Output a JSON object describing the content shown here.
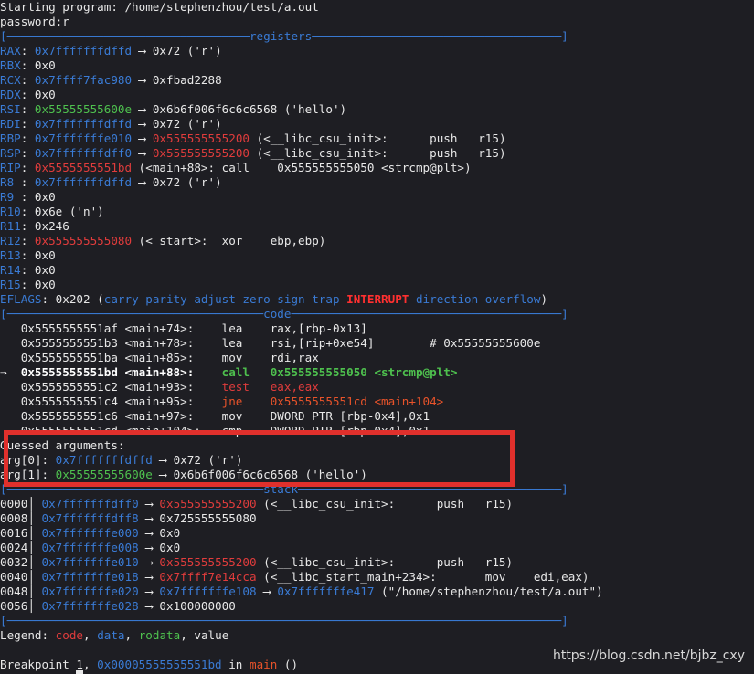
{
  "terminal": {
    "lines": [
      [
        {
          "t": "Starting program: /home/stephenzhou/test/a.out",
          "c": "white"
        }
      ],
      [
        {
          "t": "password:r",
          "c": "white"
        }
      ],
      [
        {
          "t": "[───────────────────────────────────registers────────────────────────────────────]",
          "c": "sep"
        }
      ],
      [
        {
          "t": "RAX",
          "c": "blue"
        },
        {
          "t": ": ",
          "c": "white"
        },
        {
          "t": "0x7fffffffdffd",
          "c": "blue"
        },
        {
          "t": " ⟶ 0x72 ('r')",
          "c": "white"
        }
      ],
      [
        {
          "t": "RBX",
          "c": "blue"
        },
        {
          "t": ": 0x0",
          "c": "white"
        }
      ],
      [
        {
          "t": "RCX",
          "c": "blue"
        },
        {
          "t": ": ",
          "c": "white"
        },
        {
          "t": "0x7ffff7fac980",
          "c": "blue"
        },
        {
          "t": " ⟶ 0xfbad2288",
          "c": "white"
        }
      ],
      [
        {
          "t": "RDX",
          "c": "blue"
        },
        {
          "t": ": 0x0",
          "c": "white"
        }
      ],
      [
        {
          "t": "RSI",
          "c": "blue"
        },
        {
          "t": ": ",
          "c": "white"
        },
        {
          "t": "0x55555555600e",
          "c": "green"
        },
        {
          "t": " ⟶ 0x6b6f006f6c6c6568 ('hello')",
          "c": "white"
        }
      ],
      [
        {
          "t": "RDI",
          "c": "blue"
        },
        {
          "t": ": ",
          "c": "white"
        },
        {
          "t": "0x7fffffffdffd",
          "c": "blue"
        },
        {
          "t": " ⟶ 0x72 ('r')",
          "c": "white"
        }
      ],
      [
        {
          "t": "RBP",
          "c": "blue"
        },
        {
          "t": ": ",
          "c": "white"
        },
        {
          "t": "0x7fffffffe010",
          "c": "blue"
        },
        {
          "t": " ⟶ ",
          "c": "white"
        },
        {
          "t": "0x555555555200",
          "c": "red"
        },
        {
          "t": " (<__libc_csu_init>:      push   r15)",
          "c": "white"
        }
      ],
      [
        {
          "t": "RSP",
          "c": "blue"
        },
        {
          "t": ": ",
          "c": "white"
        },
        {
          "t": "0x7fffffffdff0",
          "c": "blue"
        },
        {
          "t": " ⟶ ",
          "c": "white"
        },
        {
          "t": "0x555555555200",
          "c": "red"
        },
        {
          "t": " (<__libc_csu_init>:      push   r15)",
          "c": "white"
        }
      ],
      [
        {
          "t": "RIP",
          "c": "blue"
        },
        {
          "t": ": ",
          "c": "white"
        },
        {
          "t": "0x5555555551bd",
          "c": "red"
        },
        {
          "t": " (<main+88>: call    0x555555555050 <strcmp@plt>)",
          "c": "white"
        }
      ],
      [
        {
          "t": "R8 ",
          "c": "blue"
        },
        {
          "t": ": ",
          "c": "white"
        },
        {
          "t": "0x7fffffffdffd",
          "c": "blue"
        },
        {
          "t": " ⟶ 0x72 ('r')",
          "c": "white"
        }
      ],
      [
        {
          "t": "R9 ",
          "c": "blue"
        },
        {
          "t": ": 0x0",
          "c": "white"
        }
      ],
      [
        {
          "t": "R10",
          "c": "blue"
        },
        {
          "t": ": 0x6e ('n')",
          "c": "white"
        }
      ],
      [
        {
          "t": "R11",
          "c": "blue"
        },
        {
          "t": ": 0x246",
          "c": "white"
        }
      ],
      [
        {
          "t": "R12",
          "c": "blue"
        },
        {
          "t": ": ",
          "c": "white"
        },
        {
          "t": "0x555555555080",
          "c": "red"
        },
        {
          "t": " (<_start>:  xor    ebp,ebp)",
          "c": "white"
        }
      ],
      [
        {
          "t": "R13",
          "c": "blue"
        },
        {
          "t": ": 0x0",
          "c": "white"
        }
      ],
      [
        {
          "t": "R14",
          "c": "blue"
        },
        {
          "t": ": 0x0",
          "c": "white"
        }
      ],
      [
        {
          "t": "R15",
          "c": "blue"
        },
        {
          "t": ": 0x0",
          "c": "white"
        }
      ],
      [
        {
          "t": "EFLAGS",
          "c": "blue"
        },
        {
          "t": ": 0x202 (",
          "c": "white"
        },
        {
          "t": "carry parity adjust zero sign trap ",
          "c": "blue"
        },
        {
          "t": "INTERRUPT",
          "c": "hred"
        },
        {
          "t": " direction overflow",
          "c": "blue"
        },
        {
          "t": ")",
          "c": "white"
        }
      ],
      [
        {
          "t": "[─────────────────────────────────────code───────────────────────────────────────]",
          "c": "sep"
        }
      ],
      [
        {
          "t": "   0x5555555551af <main+74>:    lea    rax,[rbp-0x13]",
          "c": "white"
        }
      ],
      [
        {
          "t": "   0x5555555551b3 <main+78>:    lea    rsi,[rip+0xe54]        # 0x55555555600e",
          "c": "white"
        }
      ],
      [
        {
          "t": "   0x5555555551ba <main+85>:    mov    rdi,rax",
          "c": "white"
        }
      ],
      [
        {
          "t": "⇒  0x5555555551bd <main+88>:    ",
          "c": "whiteb"
        },
        {
          "t": "call   0x555555555050 <strcmp@plt>",
          "c": "greenb"
        }
      ],
      [
        {
          "t": "   0x5555555551c2 <main+93>:    ",
          "c": "white"
        },
        {
          "t": "test   eax,eax",
          "c": "red"
        }
      ],
      [
        {
          "t": "   0x5555555551c4 <main+95>:    ",
          "c": "white"
        },
        {
          "t": "jne    0x5555555551cd <main+104>",
          "c": "orange"
        }
      ],
      [
        {
          "t": "   0x5555555551c6 <main+97>:    mov    DWORD PTR [rbp-0x4],0x1",
          "c": "white"
        }
      ],
      [
        {
          "t": "   0x5555555551cd <main+104>:   cmp    DWORD PTR [rbp-0x4],0x1",
          "c": "white"
        }
      ],
      [
        {
          "t": "Guessed arguments:",
          "c": "white"
        }
      ],
      [
        {
          "t": "arg[0]: ",
          "c": "white"
        },
        {
          "t": "0x7fffffffdffd",
          "c": "blue"
        },
        {
          "t": " ⟶ 0x72 ('r')",
          "c": "white"
        }
      ],
      [
        {
          "t": "arg[1]: ",
          "c": "white"
        },
        {
          "t": "0x55555555600e",
          "c": "green"
        },
        {
          "t": " ⟶ 0x6b6f006f6c6c6568 ('hello')",
          "c": "white"
        }
      ],
      [
        {
          "t": "[─────────────────────────────────────stack──────────────────────────────────────]",
          "c": "sep"
        }
      ],
      [
        {
          "t": "0000│ ",
          "c": "white"
        },
        {
          "t": "0x7fffffffdff0",
          "c": "blue"
        },
        {
          "t": " ⟶ ",
          "c": "white"
        },
        {
          "t": "0x555555555200",
          "c": "red"
        },
        {
          "t": " (<__libc_csu_init>:      push   r15)",
          "c": "white"
        }
      ],
      [
        {
          "t": "0008│ ",
          "c": "white"
        },
        {
          "t": "0x7fffffffdff8",
          "c": "blue"
        },
        {
          "t": " ⟶ 0x725555555080",
          "c": "white"
        }
      ],
      [
        {
          "t": "0016│ ",
          "c": "white"
        },
        {
          "t": "0x7fffffffe000",
          "c": "blue"
        },
        {
          "t": " ⟶ 0x0",
          "c": "white"
        }
      ],
      [
        {
          "t": "0024│ ",
          "c": "white"
        },
        {
          "t": "0x7fffffffe008",
          "c": "blue"
        },
        {
          "t": " ⟶ 0x0",
          "c": "white"
        }
      ],
      [
        {
          "t": "0032│ ",
          "c": "white"
        },
        {
          "t": "0x7fffffffe010",
          "c": "blue"
        },
        {
          "t": " ⟶ ",
          "c": "white"
        },
        {
          "t": "0x555555555200",
          "c": "red"
        },
        {
          "t": " (<__libc_csu_init>:      push   r15)",
          "c": "white"
        }
      ],
      [
        {
          "t": "0040│ ",
          "c": "white"
        },
        {
          "t": "0x7fffffffe018",
          "c": "blue"
        },
        {
          "t": " ⟶ ",
          "c": "white"
        },
        {
          "t": "0x7ffff7e14cca",
          "c": "red"
        },
        {
          "t": " (<__libc_start_main+234>:       mov    edi,eax)",
          "c": "white"
        }
      ],
      [
        {
          "t": "0048│ ",
          "c": "white"
        },
        {
          "t": "0x7fffffffe020",
          "c": "blue"
        },
        {
          "t": " ⟶ ",
          "c": "white"
        },
        {
          "t": "0x7fffffffe108",
          "c": "blue"
        },
        {
          "t": " ⟶ ",
          "c": "white"
        },
        {
          "t": "0x7fffffffe417",
          "c": "blue"
        },
        {
          "t": " (\"/home/stephenzhou/test/a.out\")",
          "c": "white"
        }
      ],
      [
        {
          "t": "0056│ ",
          "c": "white"
        },
        {
          "t": "0x7fffffffe028",
          "c": "blue"
        },
        {
          "t": " ⟶ 0x100000000",
          "c": "white"
        }
      ],
      [
        {
          "t": "[────────────────────────────────────────────────────────────────────────────────]",
          "c": "sep"
        }
      ],
      [
        {
          "t": "Legend: ",
          "c": "white"
        },
        {
          "t": "code",
          "c": "red"
        },
        {
          "t": ", ",
          "c": "white"
        },
        {
          "t": "data",
          "c": "blue"
        },
        {
          "t": ", ",
          "c": "white"
        },
        {
          "t": "rodata",
          "c": "green"
        },
        {
          "t": ", value",
          "c": "white"
        }
      ],
      [
        {
          "t": "",
          "c": "white"
        }
      ],
      [
        {
          "t": "Breakpoint 1, ",
          "c": "white"
        },
        {
          "t": "0x00005555555551bd",
          "c": "blue"
        },
        {
          "t": " in ",
          "c": "white"
        },
        {
          "t": "main",
          "c": "orange"
        },
        {
          "t": " ()",
          "c": "white"
        }
      ]
    ]
  },
  "watermark": "https://blog.csdn.net/bjbz_cxy",
  "colors": {
    "background": "#1e1e23",
    "highlight_box": "#e0302c",
    "blue": "#3a7bd5",
    "red": "#e03c3c",
    "green": "#4ec04e",
    "orange": "#e8532a"
  }
}
